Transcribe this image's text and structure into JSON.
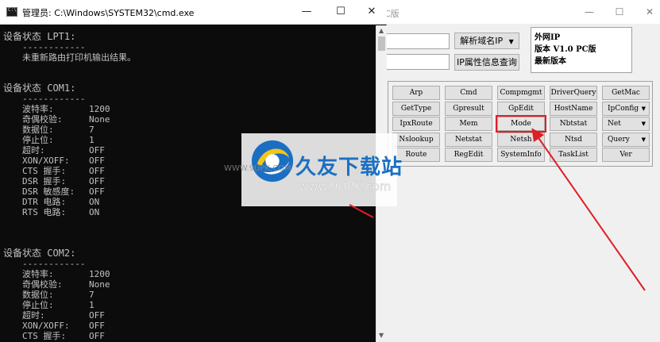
{
  "app_window": {
    "title_suffix": "C版",
    "resolve_button": "解析域名IP",
    "ip_info_button": "IP属性信息查询",
    "info_lines": [
      "外网IP",
      "版本 V1.0 PC版",
      "最新版本"
    ],
    "commands": [
      {
        "label": "Arp",
        "dropdown": false
      },
      {
        "label": "Cmd",
        "dropdown": false
      },
      {
        "label": "Compmgmt",
        "dropdown": false
      },
      {
        "label": "DriverQuery",
        "dropdown": false
      },
      {
        "label": "GetMac",
        "dropdown": false
      },
      {
        "label": "GetType",
        "dropdown": false
      },
      {
        "label": "Gpresult",
        "dropdown": false
      },
      {
        "label": "GpEdit",
        "dropdown": false
      },
      {
        "label": "HostName",
        "dropdown": false
      },
      {
        "label": "IpConfig",
        "dropdown": true
      },
      {
        "label": "IpxRoute",
        "dropdown": false
      },
      {
        "label": "Mem",
        "dropdown": false
      },
      {
        "label": "Mode",
        "dropdown": false,
        "highlighted": true
      },
      {
        "label": "Nbtstat",
        "dropdown": false
      },
      {
        "label": "Net",
        "dropdown": true
      },
      {
        "label": "Nslookup",
        "dropdown": false
      },
      {
        "label": "Netstat",
        "dropdown": false
      },
      {
        "label": "Netsh",
        "dropdown": false
      },
      {
        "label": "Ntsd",
        "dropdown": false
      },
      {
        "label": "Query",
        "dropdown": true
      },
      {
        "label": "Route",
        "dropdown": false
      },
      {
        "label": "RegEdit",
        "dropdown": false
      },
      {
        "label": "SystemInfo",
        "dropdown": false
      },
      {
        "label": "TaskList",
        "dropdown": false
      },
      {
        "label": "Ver",
        "dropdown": false
      }
    ]
  },
  "cmd_window": {
    "title": "管理员: C:\\Windows\\SYSTEM32\\cmd.exe",
    "lpt1_header": "设备状态 LPT1:",
    "separator": "------------",
    "lpt1_message": "未重新路由打印机输出结果。",
    "com1_header": "设备状态 COM1:",
    "com2_header": "设备状态 COM2:",
    "com1_rows": [
      {
        "key": "波特率:",
        "value": "1200"
      },
      {
        "key": "奇偶校验:",
        "value": "None"
      },
      {
        "key": "数据位:",
        "value": "7"
      },
      {
        "key": "停止位:",
        "value": "1"
      },
      {
        "key": "超时:",
        "value": "OFF"
      },
      {
        "key": "XON/XOFF:",
        "value": "OFF"
      },
      {
        "key": "CTS 握手:",
        "value": "OFF"
      },
      {
        "key": "DSR 握手:",
        "value": "OFF"
      },
      {
        "key": "DSR 敏感度:",
        "value": "OFF"
      },
      {
        "key": "DTR 电路:",
        "value": "ON"
      },
      {
        "key": "RTS 电路:",
        "value": "ON"
      }
    ],
    "com2_rows": [
      {
        "key": "波特率:",
        "value": "1200"
      },
      {
        "key": "奇偶校验:",
        "value": "None"
      },
      {
        "key": "数据位:",
        "value": "7"
      },
      {
        "key": "停止位:",
        "value": "1"
      },
      {
        "key": "超时:",
        "value": "OFF"
      },
      {
        "key": "XON/XOFF:",
        "value": "OFF"
      },
      {
        "key": "CTS 握手:",
        "value": "OFF"
      }
    ]
  },
  "watermark": {
    "title": "久友下载站",
    "url": "www.9UPK.com",
    "faint_url": "WWW.9UPK.COM"
  },
  "colors": {
    "console_bg": "#0c0c0c",
    "console_text": "#c0c0c0",
    "highlight": "#e01e25",
    "watermark_blue": "#1b6fc2"
  }
}
